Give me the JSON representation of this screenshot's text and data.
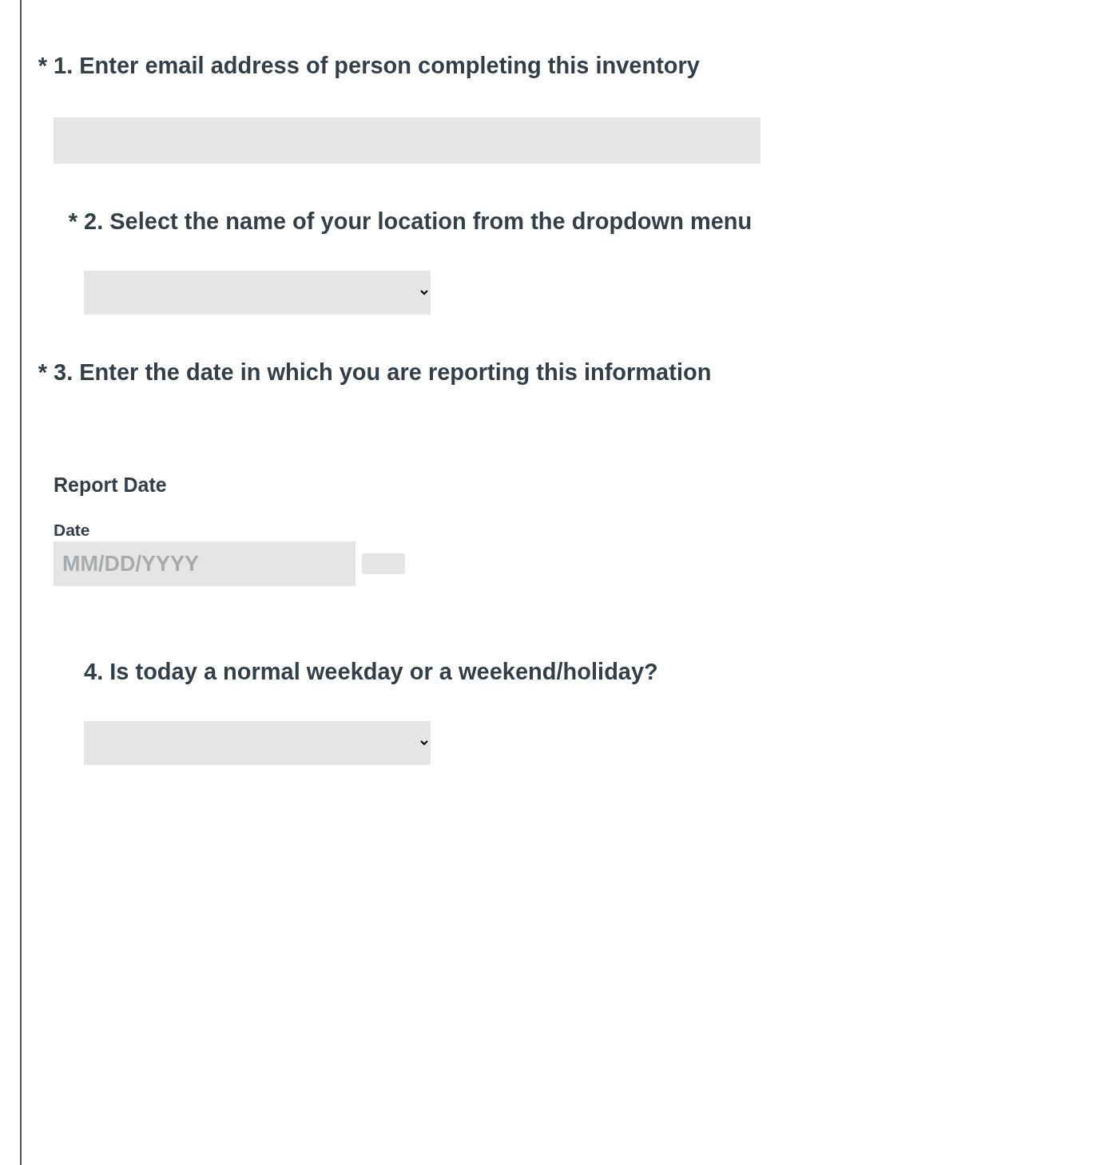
{
  "questions": [
    {
      "kind": "text",
      "required_mark": "*",
      "title": "1. Enter email address of person completing this inventory"
    },
    {
      "kind": "dropdown",
      "required_mark": "*",
      "title": "2. Select the name of your location from the dropdown menu"
    },
    {
      "kind": "date",
      "required_mark": "*",
      "title": "3. Enter the date in which you are reporting this information",
      "row_label": "Report Date",
      "field_label": "Date",
      "placeholder": "MM/DD/YYYY"
    },
    {
      "kind": "dropdown",
      "title": "4. Is today a normal weekday or a weekend/holiday?"
    }
  ]
}
